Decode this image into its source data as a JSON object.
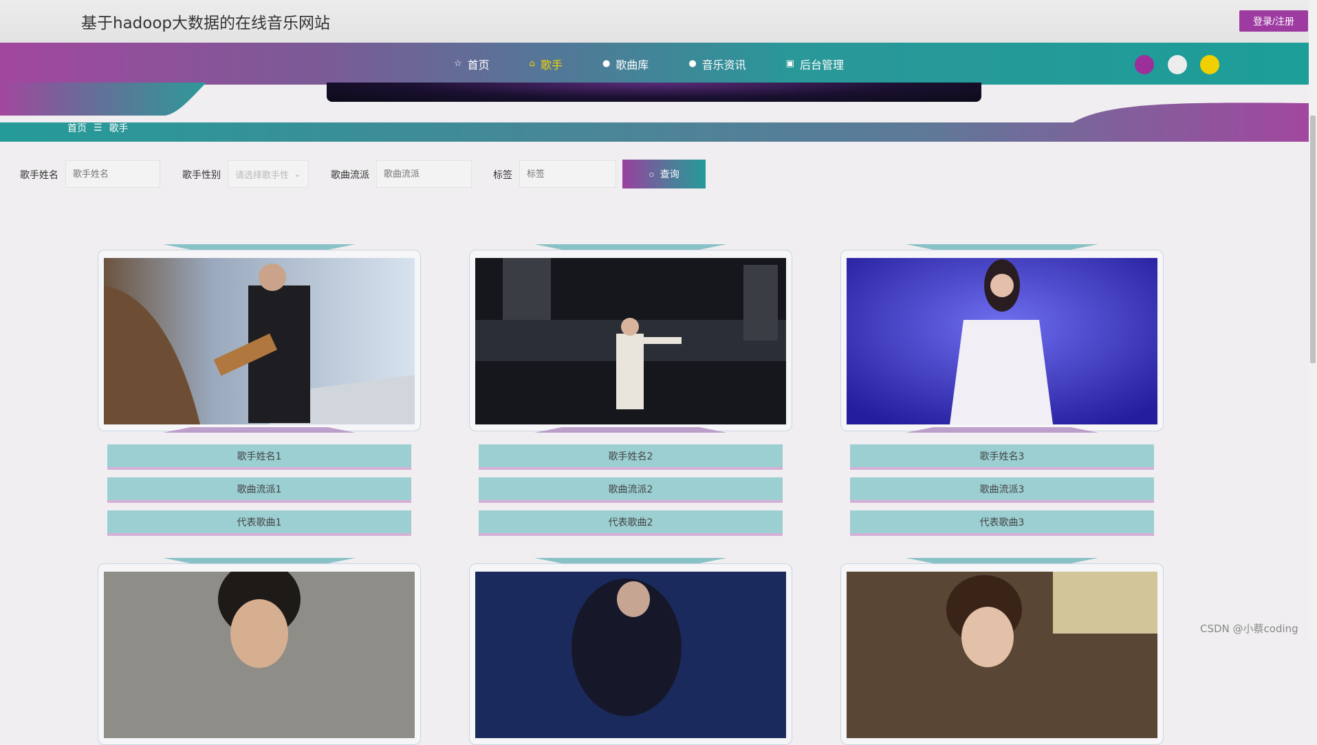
{
  "site": {
    "title": "基于hadoop大数据的在线音乐网站",
    "login_label": "登录/注册"
  },
  "nav": {
    "items": [
      {
        "label": "首页",
        "icon": "star-icon"
      },
      {
        "label": "歌手",
        "icon": "bag-icon"
      },
      {
        "label": "歌曲库",
        "icon": "info-icon"
      },
      {
        "label": "音乐资讯",
        "icon": "help-icon"
      },
      {
        "label": "后台管理",
        "icon": "lock-icon"
      }
    ],
    "active": "歌手",
    "theme_colors": [
      "#9c2f9a",
      "#ececec",
      "#f0d000"
    ]
  },
  "breadcrumb": {
    "home": "首页",
    "separator": "☰",
    "current": "歌手"
  },
  "search": {
    "name_label": "歌手姓名",
    "name_placeholder": "歌手姓名",
    "gender_label": "歌手性别",
    "gender_placeholder": "请选择歌手性",
    "genre_label": "歌曲流派",
    "genre_placeholder": "歌曲流派",
    "tag_label": "标签",
    "tag_placeholder": "标签",
    "query_label": "查询"
  },
  "singers": [
    {
      "name": "歌手姓名1",
      "genre": "歌曲流派1",
      "song": "代表歌曲1"
    },
    {
      "name": "歌手姓名2",
      "genre": "歌曲流派2",
      "song": "代表歌曲2"
    },
    {
      "name": "歌手姓名3",
      "genre": "歌曲流派3",
      "song": "代表歌曲3"
    }
  ],
  "watermark": "CSDN @小蔡coding"
}
